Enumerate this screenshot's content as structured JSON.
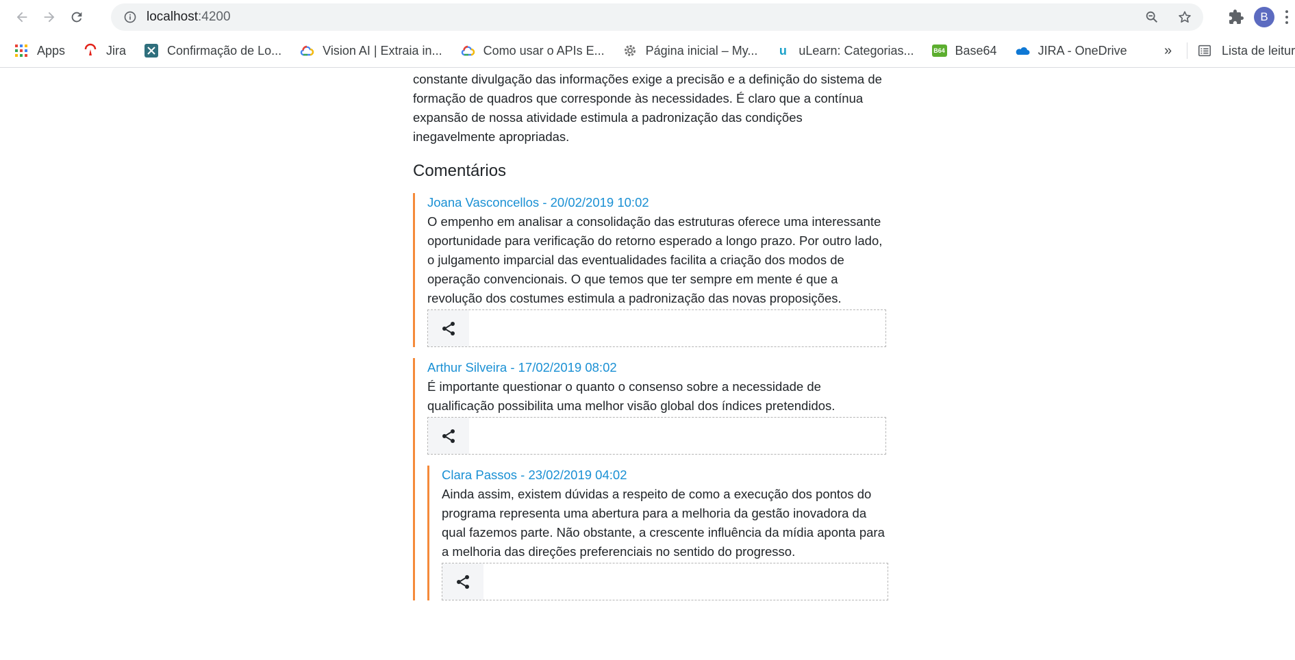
{
  "browser": {
    "url_host": "localhost",
    "url_port": ":4200",
    "avatar_letter": "B"
  },
  "bookmarks": {
    "items": [
      {
        "label": "Apps",
        "icon": "apps-grid-icon"
      },
      {
        "label": "Jira",
        "icon": "jira-icon"
      },
      {
        "label": "Confirmação de Lo...",
        "icon": "confluence-icon"
      },
      {
        "label": "Vision AI | Extraia in...",
        "icon": "google-cloud-icon"
      },
      {
        "label": "Como usar o APIs E...",
        "icon": "google-cloud-icon"
      },
      {
        "label": "Página inicial – My...",
        "icon": "gear-icon"
      },
      {
        "label": "uLearn: Categorias...",
        "icon": "ulearn-icon"
      },
      {
        "label": "Base64",
        "icon": "base64-icon"
      },
      {
        "label": "JIRA - OneDrive",
        "icon": "onedrive-icon"
      }
    ],
    "more": "»",
    "reading_list": "Lista de leitura",
    "b64_text": "B64",
    "ulearn_text": "u"
  },
  "article": {
    "text": "constante divulgação das informações exige a precisão e a definição do sistema de formação de quadros que corresponde às necessidades. É claro que a contínua expansão de nossa atividade estimula a padronização das condições inegavelmente apropriadas."
  },
  "comments": {
    "title": "Comentários",
    "items": [
      {
        "meta": "Joana Vasconcellos - 20/02/2019 10:02",
        "body": "O empenho em analisar a consolidação das estruturas oferece uma interessante oportunidade para verificação do retorno esperado a longo prazo. Por outro lado, o julgamento imparcial das eventualidades facilita a criação dos modos de operação convencionais. O que temos que ter sempre em mente é que a revolução dos costumes estimula a padronização das novas proposições."
      },
      {
        "meta": "Arthur Silveira - 17/02/2019 08:02",
        "body": "É importante questionar o quanto o consenso sobre a necessidade de qualificação possibilita uma melhor visão global dos índices pretendidos.",
        "replies": [
          {
            "meta": "Clara Passos - 23/02/2019 04:02",
            "body": "Ainda assim, existem dúvidas a respeito de como a execução dos pontos do programa representa uma abertura para a melhoria da gestão inovadora da qual fazemos parte. Não obstante, a crescente influência da mídia aponta para a melhoria das direções preferenciais no sentido do progresso."
          }
        ]
      }
    ]
  },
  "colors": {
    "accent_border": "#f58a3a",
    "meta_link": "#1a90d4"
  }
}
